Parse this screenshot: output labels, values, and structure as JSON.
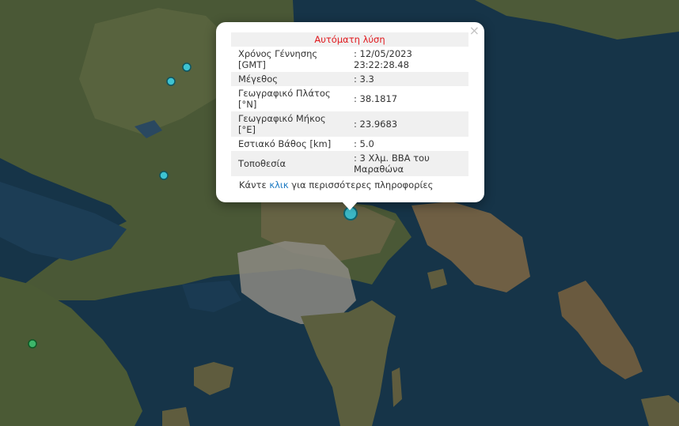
{
  "popup": {
    "header": "Αυτόματη λύση",
    "close_symbol": "×",
    "rows": [
      {
        "key": "Χρόνος Γέννησης [GMT]",
        "value": ": 12/05/2023 23:22:28.48"
      },
      {
        "key": "Μέγεθος",
        "value": ": 3.3"
      },
      {
        "key": "Γεωγραφικό Πλάτος [°N]",
        "value": ": 38.1817"
      },
      {
        "key": "Γεωγραφικό Μήκος [°E]",
        "value": ": 23.9683"
      },
      {
        "key": "Εστιακό Βάθος [km]",
        "value": ": 5.0"
      },
      {
        "key": "Τοποθεσία",
        "value": ": 3 Χλμ. ΒΒΑ του Μαραθώνα"
      }
    ],
    "more_prefix": "Κάντε",
    "more_link": "κλικ",
    "more_suffix": "για περισσότερες πληροφορίες"
  },
  "markers": [
    {
      "name": "earthquake-marker-selected",
      "color": "#3cb8c6"
    },
    {
      "name": "earthquake-marker",
      "color": "#3ec3d2"
    },
    {
      "name": "earthquake-marker",
      "color": "#3ec3d2"
    },
    {
      "name": "earthquake-marker",
      "color": "#3ec3d2"
    },
    {
      "name": "earthquake-marker",
      "color": "#3db66a"
    }
  ],
  "colors": {
    "sea": "#163448",
    "land": "#4b5a38",
    "header_text": "#e0171c",
    "link": "#1a78c2"
  }
}
